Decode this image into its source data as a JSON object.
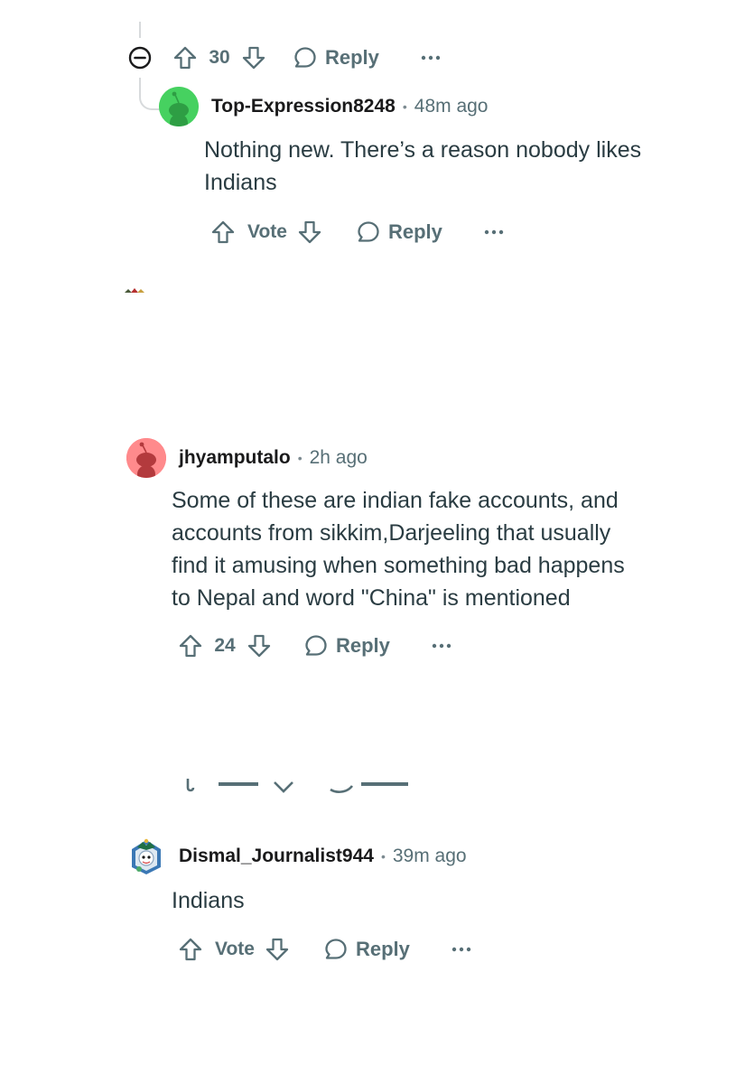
{
  "comments": [
    {
      "id": "c0",
      "collapse_icon": "minus-circle-icon",
      "vote_count": "30",
      "reply_label": "Reply"
    },
    {
      "id": "c1",
      "username": "Top-Expression8248",
      "separator": "•",
      "time": "48m ago",
      "body": "Nothing new. There’s a reason nobody likes\nIndians",
      "vote_label": "Vote",
      "reply_label": "Reply",
      "avatar_color": "#46d160"
    },
    {
      "id": "c2",
      "username": "jhyamputalo",
      "separator": "•",
      "time": "2h ago",
      "body": "Some of these are indian fake accounts, and\naccounts from sikkim,Darjeeling that usually\nfind it amusing when something bad happens\nto Nepal and word \"China\" is mentioned",
      "vote_count": "24",
      "reply_label": "Reply",
      "avatar_color": "#ff585b"
    },
    {
      "id": "c3",
      "username": "Dismal_Journalist944",
      "separator": "•",
      "time": "39m ago",
      "body": "Indians",
      "vote_label": "Vote",
      "reply_label": "Reply"
    }
  ],
  "colors": {
    "action_gray": "#576f76",
    "text_dark": "#1a1a1b",
    "body_text": "#2a3c42",
    "thread_line": "#d7dadc"
  }
}
